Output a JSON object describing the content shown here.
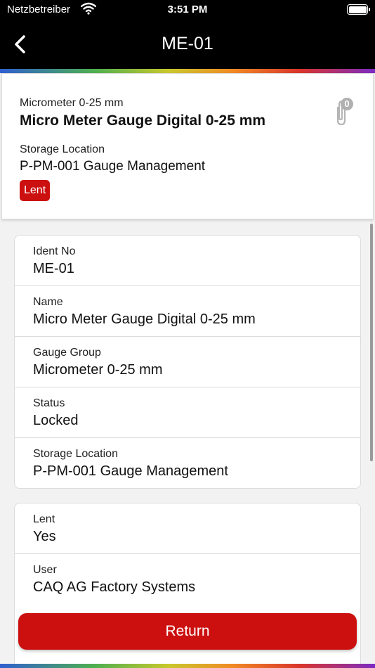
{
  "status_bar": {
    "carrier": "Netzbetreiber",
    "time": "3:51 PM"
  },
  "nav": {
    "title": "ME-01",
    "back_icon": "chevron-left-icon"
  },
  "header": {
    "gauge_group": "Micrometer 0-25 mm",
    "name": "Micro Meter Gauge Digital 0-25 mm",
    "storage_label": "Storage Location",
    "storage_value": "P-PM-001 Gauge Management",
    "badge": "Lent",
    "attachment_icon": "paperclip-icon",
    "attachment_count": "0"
  },
  "details": [
    {
      "label": "Ident No",
      "value": "ME-01"
    },
    {
      "label": "Name",
      "value": "Micro Meter Gauge Digital 0-25 mm"
    },
    {
      "label": "Gauge Group",
      "value": "Micrometer 0-25 mm"
    },
    {
      "label": "Status",
      "value": "Locked"
    },
    {
      "label": "Storage Location",
      "value": "P-PM-001 Gauge Management"
    }
  ],
  "lending": [
    {
      "label": "Lent",
      "value": "Yes"
    },
    {
      "label": "User",
      "value": "CAQ AG Factory Systems"
    }
  ],
  "actions": {
    "return_label": "Return"
  },
  "colors": {
    "accent": "#cc1010",
    "nav_background": "#000000"
  }
}
